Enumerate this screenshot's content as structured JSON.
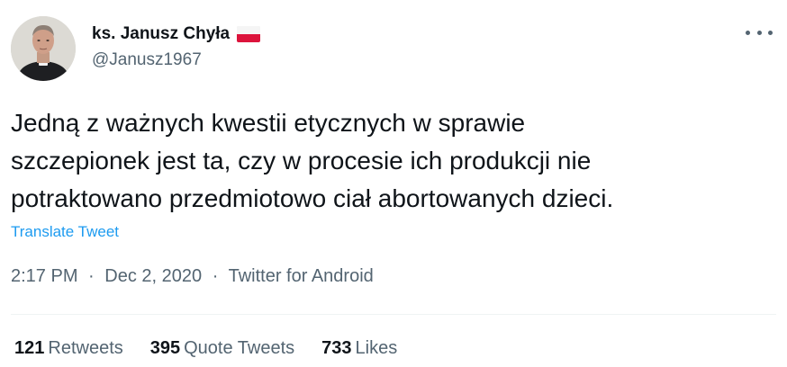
{
  "tweet": {
    "author": {
      "display_name": "ks. Janusz Chyła",
      "handle": "@Janusz1967",
      "flag_icon": "poland-flag"
    },
    "text_lines": [
      "Jedną z ważnych kwestii etycznych w sprawie",
      "szczepionek jest ta, czy w procesie ich produkcji nie",
      "potraktowano przedmiotowo ciał abortowanych dzieci."
    ],
    "translate_label": "Translate Tweet",
    "time": "2:17 PM",
    "separator": "·",
    "date": "Dec 2, 2020",
    "source": "Twitter for Android",
    "stats": {
      "retweets_count": "121",
      "retweets_label": "Retweets",
      "quotes_count": "395",
      "quotes_label": "Quote Tweets",
      "likes_count": "733",
      "likes_label": "Likes"
    }
  },
  "colors": {
    "text": "#0f1419",
    "secondary": "#536471",
    "link": "#1d9bf0",
    "divider": "#eff3f4",
    "flag_red": "#dc143c"
  }
}
